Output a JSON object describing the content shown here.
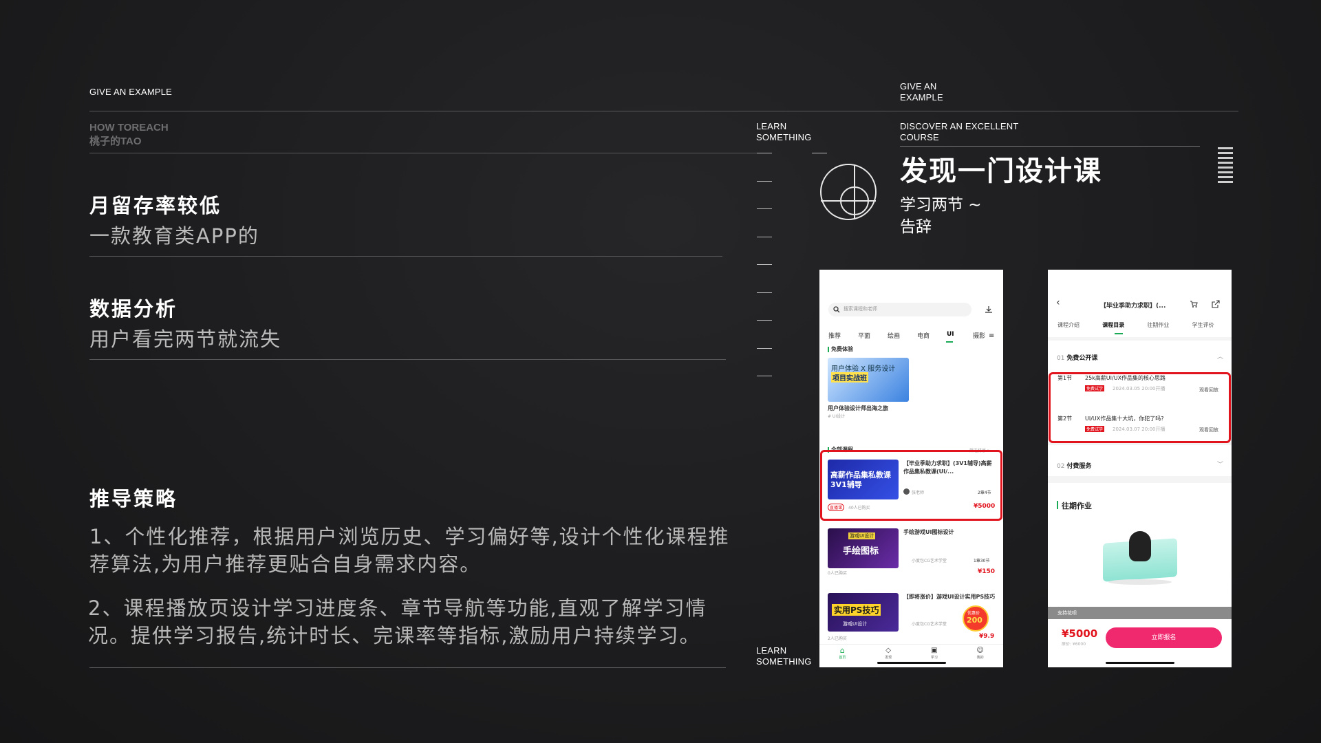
{
  "left": {
    "eyebrow": "GIVE AN EXAMPLE",
    "brand_line1": "HOW TOREACH",
    "brand_line2": "桃子的TAO",
    "section1": {
      "title": "月留存率较低",
      "subtitle": "一款教育类APP的"
    },
    "section2": {
      "title": "数据分析",
      "subtitle": "用户看完两节就流失"
    },
    "section3": {
      "title": "推导策略",
      "para1": "1、个性化推荐，根据用户浏览历史、学习偏好等,设计个性化课程推荐算法,为用户推荐更贴合自身需求内容。",
      "para2": "2、课程播放页设计学习进度条、章节导航等功能,直观了解学习情况。提供学习报告,统计时长、完课率等指标,激励用户持续学习。"
    }
  },
  "middle": {
    "learn_top": "LEARN SOMETHING",
    "learn_bottom": "LEARN SOMETHING"
  },
  "right": {
    "eyebrow": "GIVE AN EXAMPLE",
    "discover": "DISCOVER AN EXCELLENT COURSE",
    "title": "发现一门设计课",
    "subtitle_line1": "学习两节 ~",
    "subtitle_line2": "告辞"
  },
  "phone1": {
    "search_placeholder": "搜索课程和老师",
    "tabs": [
      "推荐",
      "平面",
      "绘画",
      "电商",
      "UI",
      "摄影"
    ],
    "active_tab": "UI",
    "section_free": "免费体验",
    "banner_text1": "用户体验 X 服务设计",
    "banner_text2": "项目实战班",
    "banner_caption": "用户体验设计师出海之旅",
    "banner_tag": "# UI设计",
    "section_all": "全部课程",
    "section_all_more": "筛选排序 >",
    "courses": [
      {
        "title": "【毕业季助力求职】(3V1辅导)高薪作品集私教课(UI/...",
        "thumb_text": "高薪作品集私教课",
        "thumb_sub": "3V1辅导",
        "teacher": "张老师",
        "meta": "2章4节",
        "badge": "直播课",
        "buyers": "40人已购买",
        "price": "¥5000"
      },
      {
        "title": "手绘游戏UI图标设计",
        "thumb_text": "手绘图标",
        "thumb_sub": "游戏UI设计",
        "teacher": "小度包CG艺术学堂",
        "meta": "1章30节",
        "buyers": "0人已购买",
        "price": "¥150"
      },
      {
        "title": "【即将涨价】游戏UI设计实用PS技巧",
        "thumb_text": "实用PS技巧",
        "thumb_sub": "游戏UI设计",
        "teacher": "小度包CG艺术学堂",
        "buyers": "2人已购买",
        "price": "¥9.9",
        "promo": "200",
        "promo_label": "优惠价"
      }
    ],
    "nav": [
      "首页",
      "发现",
      "学习",
      "我的"
    ]
  },
  "phone2": {
    "title": "【毕业季助力求职】(...",
    "tabs": [
      "课程介绍",
      "课程目录",
      "往期作业",
      "学生评价"
    ],
    "active_tab": "课程目录",
    "group1": {
      "num": "01",
      "label": "免费公开课"
    },
    "lessons": [
      {
        "num": "第1节",
        "title": "25k高薪UI/UX作品集的核心思路",
        "badge": "免费试学",
        "date": "2024.03.05 20:00开播",
        "action": "观看回放"
      },
      {
        "num": "第2节",
        "title": "UI/UX作品集十大坑，你犯了吗?",
        "badge": "免费试学",
        "date": "2024.03.07 20:00开播",
        "action": "观看回放"
      }
    ],
    "group2": {
      "num": "02",
      "label": "付费服务"
    },
    "homework": "往期作业",
    "support": "支持花呗",
    "price": "¥5000",
    "orig_price": "原价: ¥6000",
    "cta": "立即报名"
  },
  "colors": {
    "accent_red": "#e1141e",
    "cta_pink": "#f0296e",
    "green": "#1aaa55"
  }
}
